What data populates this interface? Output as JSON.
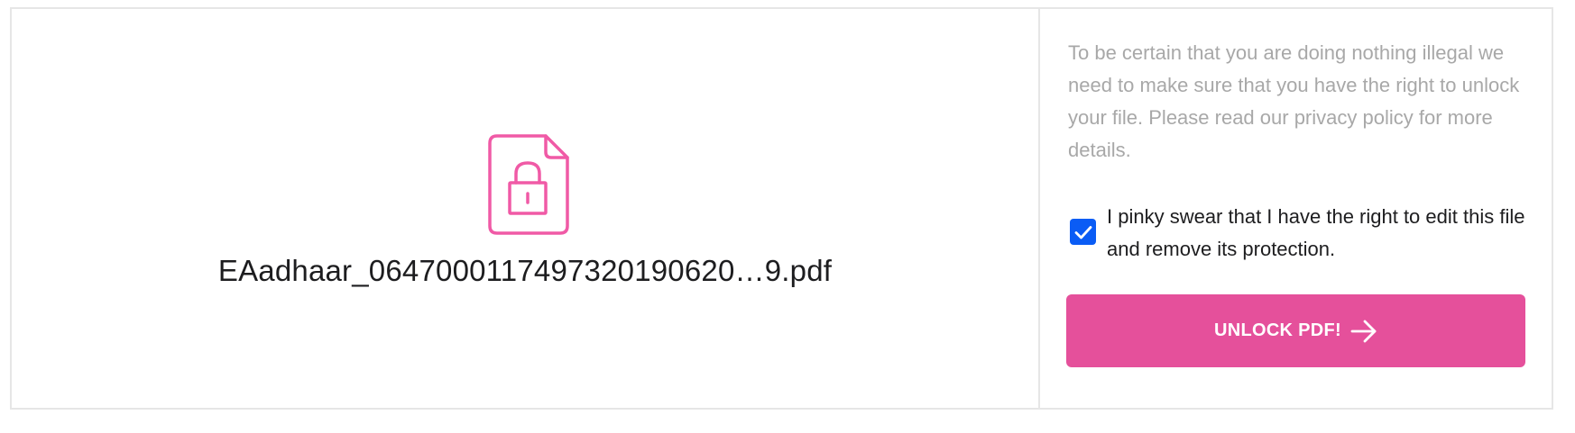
{
  "file": {
    "name": "EAadhaar_0647000117497320190620…9.pdf",
    "icon": "locked-file-icon",
    "icon_color": "#f05aa6"
  },
  "notice": {
    "text": "To be certain that you are doing nothing illegal we need to make sure that you have the right to unlock your file. Please read our privacy policy for more details."
  },
  "consent": {
    "checked": true,
    "label": "I pinky swear that I have the right to edit this file and remove its protection.",
    "checkbox_color": "#0a5cf5"
  },
  "action": {
    "button_label": "UNLOCK PDF!",
    "button_color": "#e5509b",
    "icon": "arrow-right-icon"
  }
}
